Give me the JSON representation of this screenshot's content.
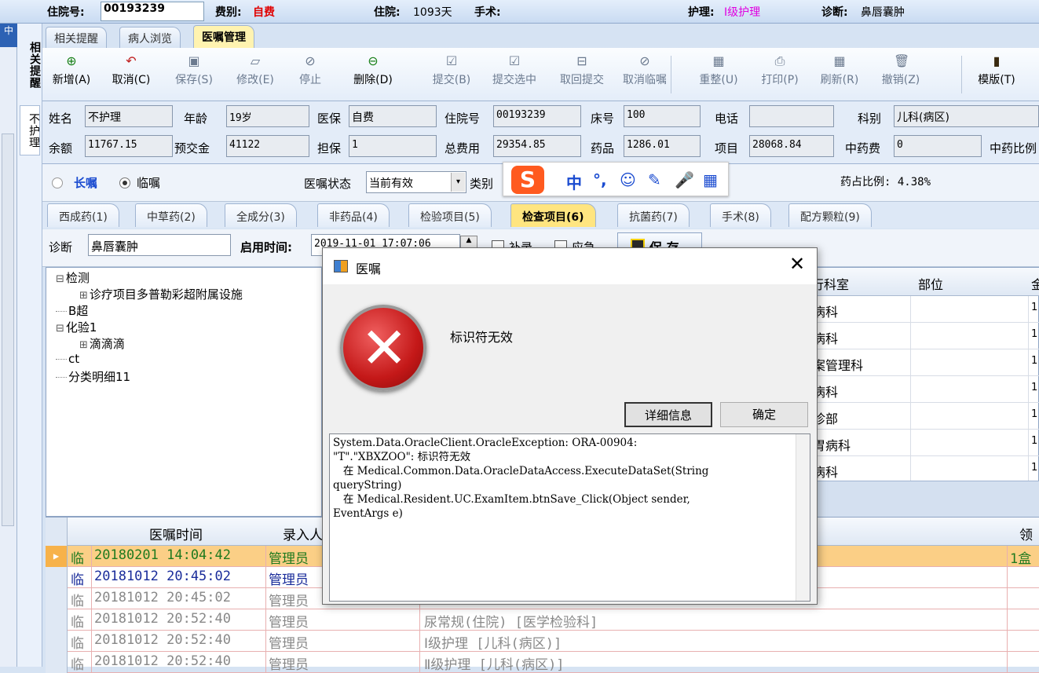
{
  "header": {
    "admission_label": "住院号:",
    "admission_no": "00193239",
    "fee_label": "费别:",
    "fee_value": "自费",
    "stay_label": "住院:",
    "stay_value": "1093天",
    "surgery_label": "手术:",
    "surgery_value": "",
    "nursing_label": "护理:",
    "nursing_value": "Ⅰ级护理",
    "diagnosis_label": "诊断:",
    "diagnosis_value": "鼻唇囊肿"
  },
  "left_strip": {
    "top_label": "中"
  },
  "vertical_nav": {
    "items": [
      "相关提醒",
      "不护理"
    ]
  },
  "tabs": [
    "相关提醒",
    "病人浏览",
    "医嘱管理"
  ],
  "toolbar": [
    {
      "label": "新增(A)",
      "icon": "plus-circle-icon",
      "glyph": "⊕",
      "enabled": true
    },
    {
      "label": "取消(C)",
      "icon": "undo-icon",
      "glyph": "↶",
      "enabled": true
    },
    {
      "label": "保存(S)",
      "icon": "save-icon",
      "glyph": "▣",
      "enabled": false
    },
    {
      "label": "修改(E)",
      "icon": "edit-icon",
      "glyph": "▱",
      "enabled": false
    },
    {
      "label": "停止",
      "icon": "stop-icon",
      "glyph": "⊘",
      "enabled": false
    },
    {
      "label": "删除(D)",
      "icon": "delete-icon",
      "glyph": "⊖",
      "enabled": true
    },
    {
      "label": "提交(B)",
      "icon": "submit-icon",
      "glyph": "☑",
      "enabled": false
    },
    {
      "label": "提交选中",
      "icon": "submit-selected-icon",
      "glyph": "☑",
      "enabled": false
    },
    {
      "label": "取回提交",
      "icon": "retrieve-icon",
      "glyph": "⊟",
      "enabled": false
    },
    {
      "label": "取消临嘱",
      "icon": "cancel-temp-icon",
      "glyph": "⊘",
      "enabled": false
    },
    {
      "label": "重整(U)",
      "icon": "reorganize-icon",
      "glyph": "▦",
      "enabled": false
    },
    {
      "label": "打印(P)",
      "icon": "print-icon",
      "glyph": "⎙",
      "enabled": false
    },
    {
      "label": "刷新(R)",
      "icon": "refresh-icon",
      "glyph": "▦",
      "enabled": false
    },
    {
      "label": "撤销(Z)",
      "icon": "trash-icon",
      "glyph": "🗑",
      "enabled": false
    },
    {
      "label": "模版(T)",
      "icon": "template-icon",
      "glyph": "▮",
      "enabled": true
    }
  ],
  "patient": {
    "name_label": "姓名",
    "name": "不护理",
    "age_label": "年龄",
    "age": "19岁",
    "insurance_label": "医保",
    "insurance": "自费",
    "admission_label": "住院号",
    "admission": "00193239",
    "bed_label": "床号",
    "bed": "100",
    "phone_label": "电话",
    "phone": "",
    "dept_label": "科别",
    "dept": "儿科(病区)",
    "balance_label": "余额",
    "balance": "11767.15",
    "prepay_label": "预交金",
    "prepay": "41122",
    "guarantee_label": "担保",
    "guarantee": "1",
    "total_label": "总费用",
    "total": "29354.85",
    "drug_label": "药品",
    "drug": "1286.01",
    "item_label": "项目",
    "item": "28068.84",
    "herb_label": "中药费",
    "herb": "0",
    "herb_ratio_label": "中药比例"
  },
  "order_bar": {
    "long_label": "长嘱",
    "temp_label": "临嘱",
    "status_label": "医嘱状态",
    "status_value": "当前有效",
    "category_label": "类别",
    "drug_ratio": "药占比例: 4.38%"
  },
  "ime": {
    "logo": "S",
    "items": [
      "中",
      "°,",
      "☺",
      "✎",
      "🎤",
      "▦"
    ]
  },
  "sub_tabs": [
    "西成药(1)",
    "中草药(2)",
    "全成分(3)",
    "非药品(4)",
    "检验项目(5)",
    "检查项目(6)",
    "抗菌药(7)",
    "手术(8)",
    "配方颗粒(9)"
  ],
  "diag_bar": {
    "diag_label": "诊断",
    "diag_value": "鼻唇囊肿",
    "start_label": "启用时间:",
    "start_value": "2019-11-01 17:07:06",
    "supplement_label": "补录",
    "emergency_label": "应急",
    "save_label": "保 存"
  },
  "tree": [
    {
      "text": "检测",
      "level": 0,
      "toggle": "⊟"
    },
    {
      "text": "诊疗项目多普勒彩超附属设施",
      "level": 1,
      "toggle": "⊞"
    },
    {
      "text": "B超",
      "level": 0,
      "toggle": ""
    },
    {
      "text": "化验1",
      "level": 0,
      "toggle": "⊟"
    },
    {
      "text": "滴滴滴",
      "level": 1,
      "toggle": "⊞"
    },
    {
      "text": "ct",
      "level": 0,
      "toggle": ""
    },
    {
      "text": "分类明细11",
      "level": 0,
      "toggle": ""
    }
  ],
  "right_grid": {
    "headers": [
      "行科室",
      "部位",
      "金"
    ],
    "rows": [
      {
        "dept": "病科",
        "part": "",
        "qty": "1"
      },
      {
        "dept": "病科",
        "part": "",
        "qty": "1"
      },
      {
        "dept": "案管理科",
        "part": "",
        "qty": "1"
      },
      {
        "dept": "病科",
        "part": "",
        "qty": "1"
      },
      {
        "dept": "诊部",
        "part": "",
        "qty": "1"
      },
      {
        "dept": "胃病科",
        "part": "",
        "qty": "1"
      },
      {
        "dept": "病科",
        "part": "",
        "qty": "1"
      }
    ]
  },
  "bottom_grid": {
    "headers": [
      "医嘱时间",
      "录入人",
      "领药"
    ],
    "rows": [
      {
        "type": "临",
        "time": "20180201 14:04:42",
        "user": "管理员",
        "content": "",
        "tail": "1盒"
      },
      {
        "type": "临",
        "time": "20181012 20:45:02",
        "user": "管理员",
        "content": "",
        "tail": ""
      },
      {
        "type": "临",
        "time": "20181012 20:45:02",
        "user": "管理员",
        "content": "",
        "tail": ""
      },
      {
        "type": "临",
        "time": "20181012 20:52:40",
        "user": "管理员",
        "content": "尿常规(住院)    [医学检验科]",
        "tail": ""
      },
      {
        "type": "临",
        "time": "20181012 20:52:40",
        "user": "管理员",
        "content": "Ⅰ级护理    [儿科(病区)]",
        "tail": ""
      },
      {
        "type": "临",
        "time": "20181012 20:52:40",
        "user": "管理员",
        "content": "Ⅱ级护理    [儿科(病区)]",
        "tail": ""
      }
    ]
  },
  "dialog": {
    "title": "医嘱",
    "message": "标识符无效",
    "details_button": "详细信息",
    "ok_button": "确定",
    "details_lines": [
      "System.Data.OracleClient.OracleException: ORA-00904:",
      "\"T\".\"XBXZOO\": 标识符无效",
      "   在 Medical.Common.Data.OracleDataAccess.ExecuteDataSet(String",
      "queryString)",
      "   在 Medical.Resident.UC.ExamItem.btnSave_Click(Object sender,",
      "EventArgs e)"
    ]
  },
  "colors": {
    "accent_blue": "#1a4bd0",
    "error_red": "#d42a2a",
    "tab_active": "#ffe580",
    "selected_row": "#fbcf86"
  }
}
